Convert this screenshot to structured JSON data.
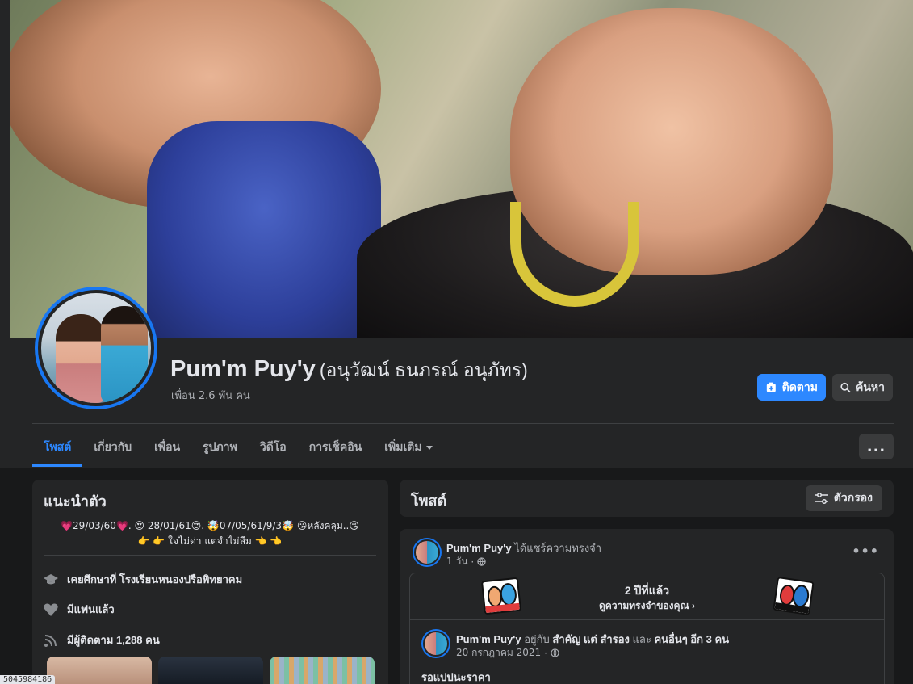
{
  "profile": {
    "name": "Pum'm Puy'y",
    "alternate_name": "(อนุวัฒน์ ธนภรณ์ อนุภัทร)",
    "friends_count": "เพื่อน 2.6 พัน คน"
  },
  "actions": {
    "follow_label": "ติดตาม",
    "search_label": "ค้นหา",
    "more_label": "..."
  },
  "tabs": [
    {
      "label": "โพสต์",
      "active": true
    },
    {
      "label": "เกี่ยวกับ",
      "active": false
    },
    {
      "label": "เพื่อน",
      "active": false
    },
    {
      "label": "รูปภาพ",
      "active": false
    },
    {
      "label": "วิดีโอ",
      "active": false
    },
    {
      "label": "การเช็คอิน",
      "active": false
    },
    {
      "label": "เพิ่มเติม",
      "active": false
    }
  ],
  "intro": {
    "title": "แนะนำตัว",
    "bio_line1": "💗29/03/60💗. 😍 28/01/61😍. 🤯07/05/61/9/3🤯 😘หลังคลุม..😘",
    "bio_line2": "👉 👉 ใจไม่ด่า แต่จำไม่ลืม 👈 👈",
    "education": "เคยศึกษาที่ โรงเรียนหนองปรือพิทยาคม",
    "relationship": "มีแฟนแล้ว",
    "followers": "มีผู้ติดตาม 1,288 คน"
  },
  "posts": {
    "title": "โพสต์",
    "filter_label": "ตัวกรอง",
    "items": [
      {
        "author": "Pum'm Puy'y",
        "action": "ได้แชร์ความทรงจำ",
        "time": "1 วัน",
        "memory_years": "2 ปีที่แล้ว",
        "memory_link": "ดูความทรงจำของคุณ",
        "inner_author": "Pum'm Puy'y",
        "inner_with": "อยู่กับ",
        "inner_tagged": "สำคัญ แต่ สำรอง",
        "inner_and": "และ",
        "inner_others": "คนอื่นๆ อีก 3 คน",
        "inner_date": "20 กรกฎาคม 2021",
        "inner_text": "รอแปปนะราคา"
      }
    ]
  },
  "overlay": {
    "id_badge": "5045984186"
  },
  "colors": {
    "accent": "#2d88ff",
    "background": "#18191a",
    "card": "#242526",
    "secondary_button": "#3a3b3c"
  }
}
